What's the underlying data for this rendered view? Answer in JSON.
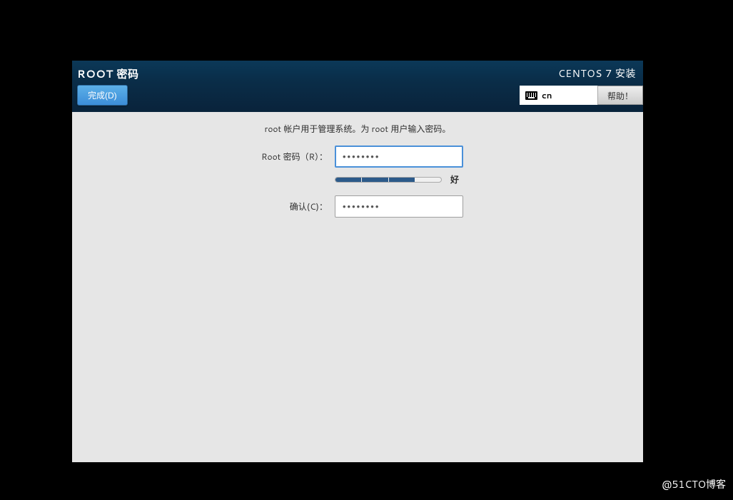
{
  "header": {
    "title": "ROOT 密码",
    "done_button": "完成(D)",
    "installer_name": "CENTOS 7 安装",
    "keyboard_layout": "cn",
    "help_button": "帮助！"
  },
  "main": {
    "description": "root 帐户用于管理系统。为 root 用户输入密码。",
    "root_password_label": "Root 密码（R）：",
    "root_password_value": "••••••••",
    "strength_text": "好",
    "strength_filled": 3,
    "strength_total": 4,
    "confirm_label": "确认(C)：",
    "confirm_value": "••••••••"
  },
  "watermark": "@51CTO博客"
}
